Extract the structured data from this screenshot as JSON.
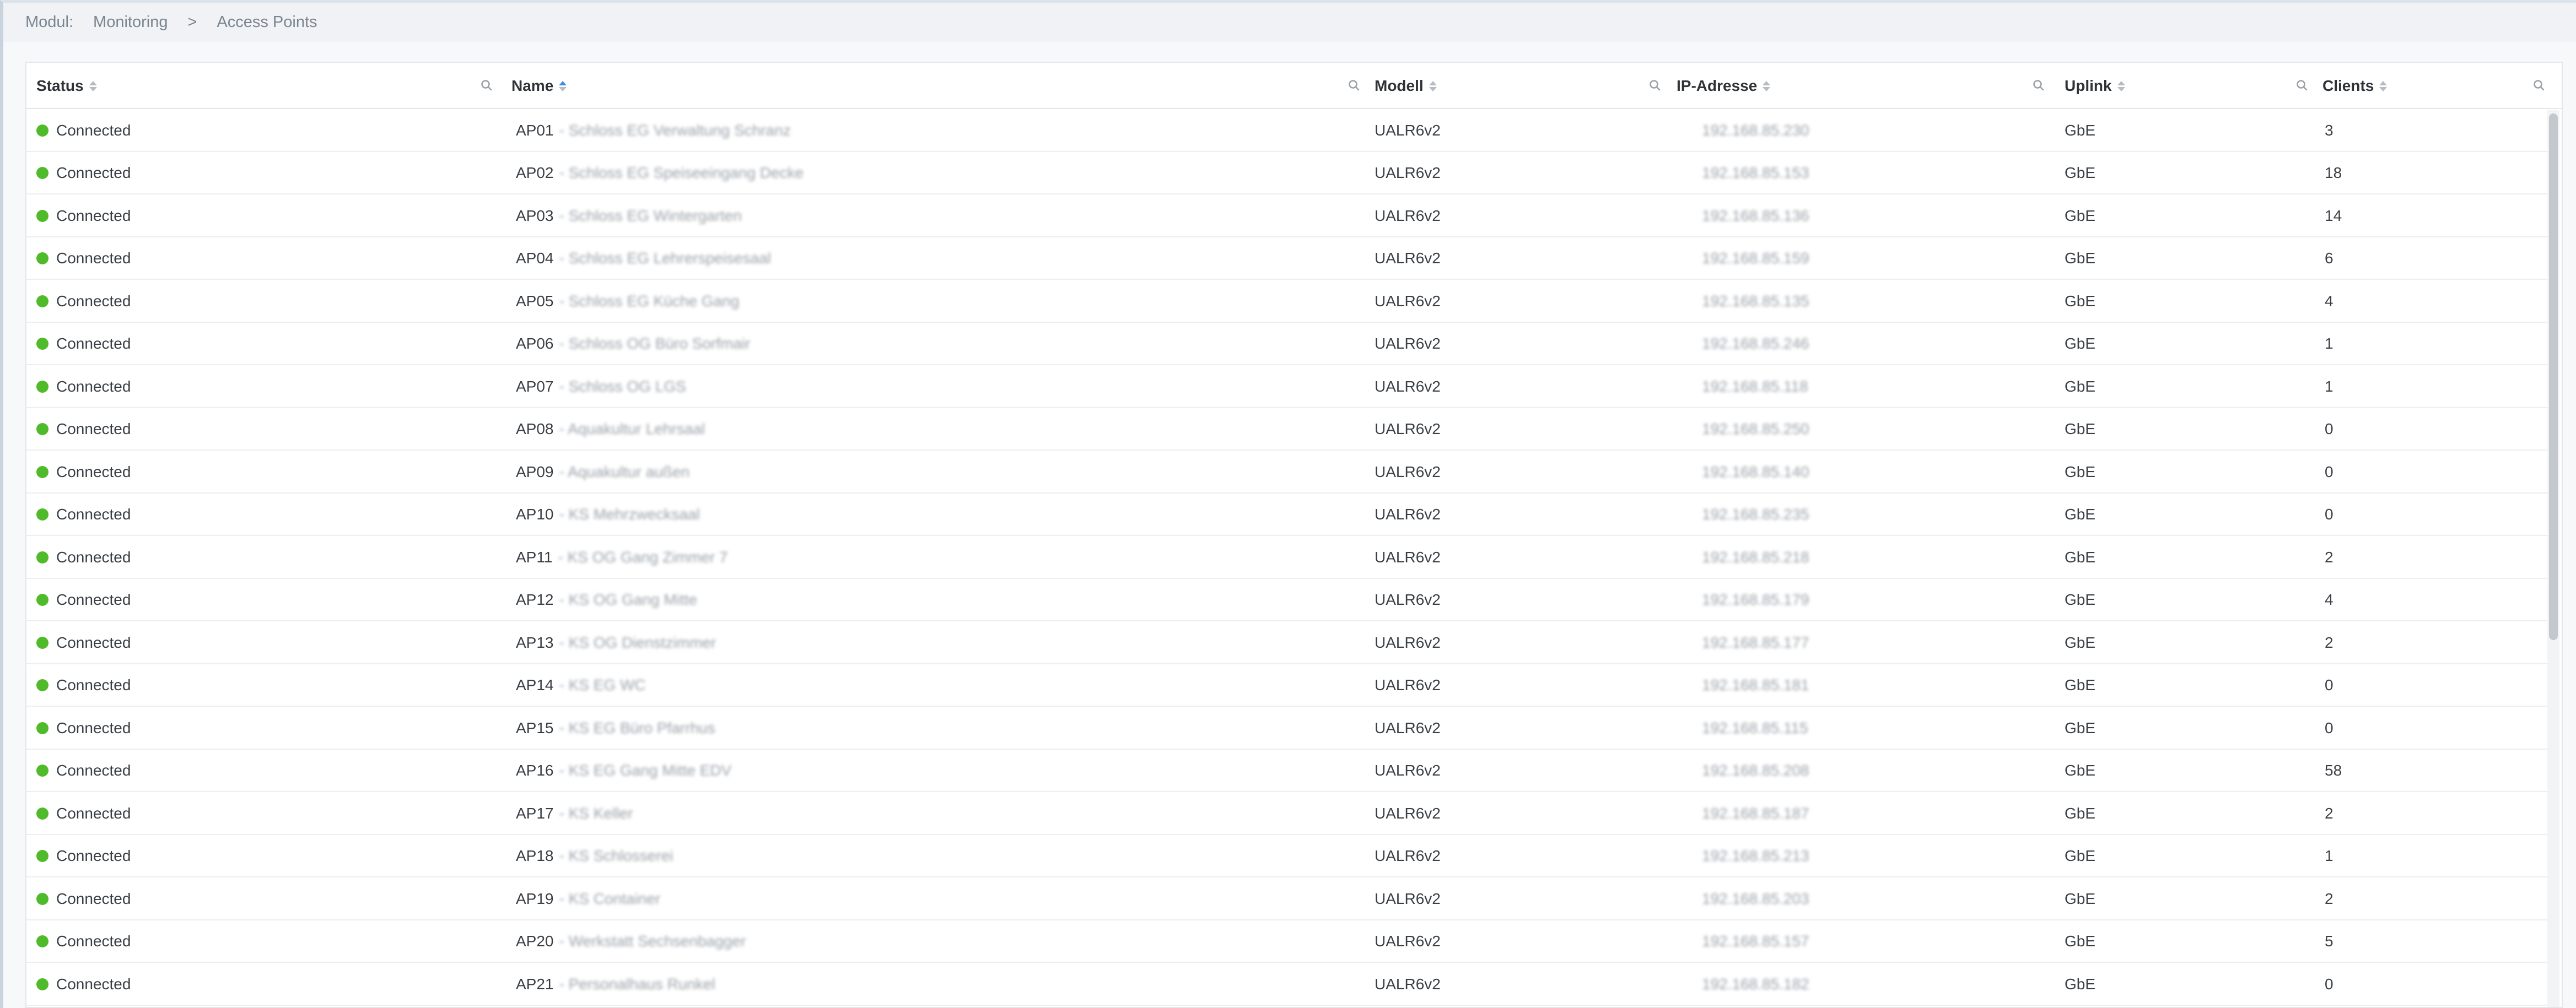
{
  "breadcrumb": {
    "module_label": "Modul:",
    "section": "Monitoring",
    "separator": ">",
    "current": "Access Points"
  },
  "table": {
    "columns": [
      {
        "key": "status",
        "label": "Status",
        "sorted": false
      },
      {
        "key": "name",
        "label": "Name",
        "sorted": "asc"
      },
      {
        "key": "model",
        "label": "Modell",
        "sorted": false
      },
      {
        "key": "ip",
        "label": "IP-Adresse",
        "sorted": false
      },
      {
        "key": "uplink",
        "label": "Uplink",
        "sorted": false
      },
      {
        "key": "clients",
        "label": "Clients",
        "sorted": false
      }
    ],
    "rows": [
      {
        "status": "Connected",
        "name": "AP01",
        "name_suffix": "- Schloss EG Verwaltung Schranz",
        "model": "UALR6v2",
        "ip": "192.168.85.230",
        "uplink": "GbE",
        "clients": "3"
      },
      {
        "status": "Connected",
        "name": "AP02",
        "name_suffix": "- Schloss EG Speiseeingang Decke",
        "model": "UALR6v2",
        "ip": "192.168.85.153",
        "uplink": "GbE",
        "clients": "18"
      },
      {
        "status": "Connected",
        "name": "AP03",
        "name_suffix": "- Schloss EG Wintergarten",
        "model": "UALR6v2",
        "ip": "192.168.85.136",
        "uplink": "GbE",
        "clients": "14"
      },
      {
        "status": "Connected",
        "name": "AP04",
        "name_suffix": "- Schloss EG Lehrerspeisesaal",
        "model": "UALR6v2",
        "ip": "192.168.85.159",
        "uplink": "GbE",
        "clients": "6"
      },
      {
        "status": "Connected",
        "name": "AP05",
        "name_suffix": "- Schloss EG Küche Gang",
        "model": "UALR6v2",
        "ip": "192.168.85.135",
        "uplink": "GbE",
        "clients": "4"
      },
      {
        "status": "Connected",
        "name": "AP06",
        "name_suffix": "- Schloss OG Büro Sorfmair",
        "model": "UALR6v2",
        "ip": "192.168.85.246",
        "uplink": "GbE",
        "clients": "1"
      },
      {
        "status": "Connected",
        "name": "AP07",
        "name_suffix": "- Schloss OG LGS",
        "model": "UALR6v2",
        "ip": "192.168.85.118",
        "uplink": "GbE",
        "clients": "1"
      },
      {
        "status": "Connected",
        "name": "AP08",
        "name_suffix": "- Aquakultur Lehrsaal",
        "model": "UALR6v2",
        "ip": "192.168.85.250",
        "uplink": "GbE",
        "clients": "0"
      },
      {
        "status": "Connected",
        "name": "AP09",
        "name_suffix": "- Aquakultur außen",
        "model": "UALR6v2",
        "ip": "192.168.85.140",
        "uplink": "GbE",
        "clients": "0"
      },
      {
        "status": "Connected",
        "name": "AP10",
        "name_suffix": "- KS Mehrzwecksaal",
        "model": "UALR6v2",
        "ip": "192.168.85.235",
        "uplink": "GbE",
        "clients": "0"
      },
      {
        "status": "Connected",
        "name": "AP11",
        "name_suffix": "- KS OG Gang Zimmer 7",
        "model": "UALR6v2",
        "ip": "192.168.85.218",
        "uplink": "GbE",
        "clients": "2"
      },
      {
        "status": "Connected",
        "name": "AP12",
        "name_suffix": "- KS OG Gang Mitte",
        "model": "UALR6v2",
        "ip": "192.168.85.179",
        "uplink": "GbE",
        "clients": "4"
      },
      {
        "status": "Connected",
        "name": "AP13",
        "name_suffix": "- KS OG Dienstzimmer",
        "model": "UALR6v2",
        "ip": "192.168.85.177",
        "uplink": "GbE",
        "clients": "2"
      },
      {
        "status": "Connected",
        "name": "AP14",
        "name_suffix": "- KS EG WC",
        "model": "UALR6v2",
        "ip": "192.168.85.181",
        "uplink": "GbE",
        "clients": "0"
      },
      {
        "status": "Connected",
        "name": "AP15",
        "name_suffix": "- KS EG Büro Pfarrhus",
        "model": "UALR6v2",
        "ip": "192.168.85.115",
        "uplink": "GbE",
        "clients": "0"
      },
      {
        "status": "Connected",
        "name": "AP16",
        "name_suffix": "- KS EG Gang Mitte EDV",
        "model": "UALR6v2",
        "ip": "192.168.85.208",
        "uplink": "GbE",
        "clients": "58"
      },
      {
        "status": "Connected",
        "name": "AP17",
        "name_suffix": "- KS Keller",
        "model": "UALR6v2",
        "ip": "192.168.85.187",
        "uplink": "GbE",
        "clients": "2"
      },
      {
        "status": "Connected",
        "name": "AP18",
        "name_suffix": "- KS Schlosserei",
        "model": "UALR6v2",
        "ip": "192.168.85.213",
        "uplink": "GbE",
        "clients": "1"
      },
      {
        "status": "Connected",
        "name": "AP19",
        "name_suffix": "- KS Container",
        "model": "UALR6v2",
        "ip": "192.168.85.203",
        "uplink": "GbE",
        "clients": "2"
      },
      {
        "status": "Connected",
        "name": "AP20",
        "name_suffix": "- Werkstatt Sechsenbagger",
        "model": "UALR6v2",
        "ip": "192.168.85.157",
        "uplink": "GbE",
        "clients": "5"
      },
      {
        "status": "Connected",
        "name": "AP21",
        "name_suffix": "- Personalhaus Runkel",
        "model": "UALR6v2",
        "ip": "192.168.85.182",
        "uplink": "GbE",
        "clients": "0"
      }
    ]
  },
  "icons": {
    "filter": "search-icon",
    "status_ok": "green-dot-icon"
  },
  "colors": {
    "status_connected": "#4fbb2a",
    "sort_active": "#3d8fe0"
  }
}
